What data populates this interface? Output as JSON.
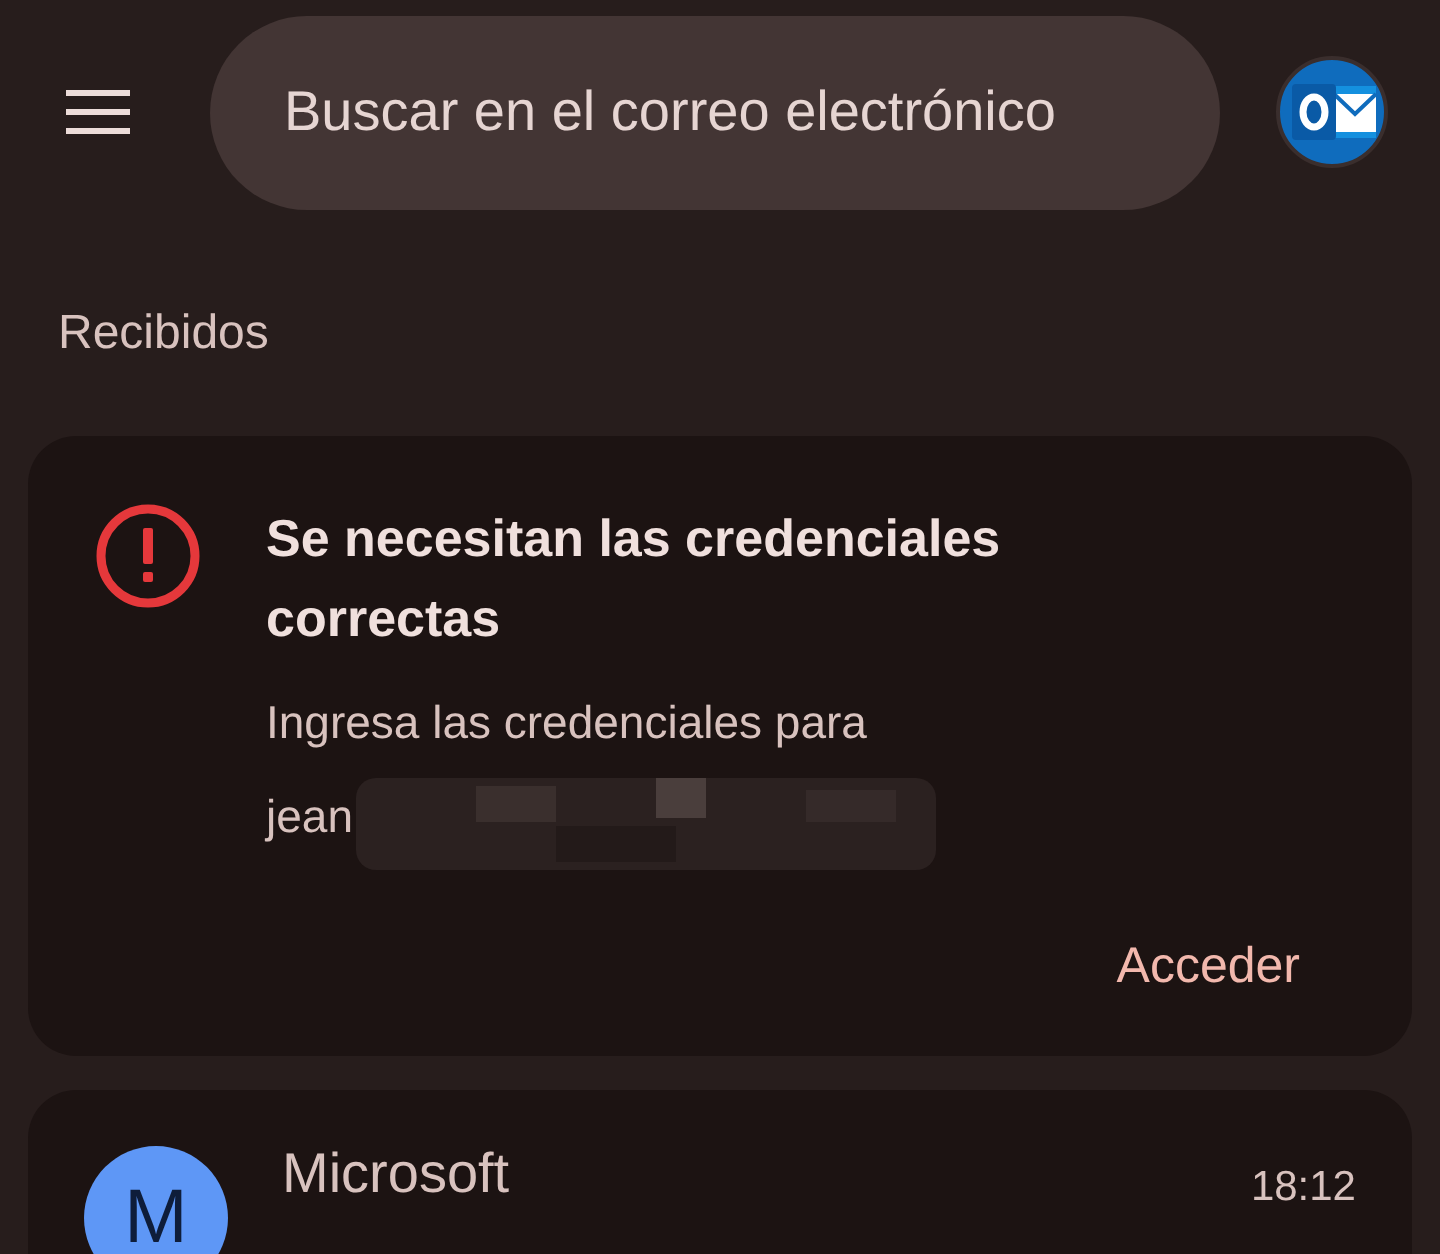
{
  "search": {
    "placeholder": "Buscar en el correo electrónico"
  },
  "section_title": "Recibidos",
  "alert": {
    "title": "Se necesitan las credenciales correctas",
    "message": "Ingresa las credenciales para",
    "account": "jean",
    "action": "Acceder"
  },
  "emails": [
    {
      "avatar_letter": "M",
      "sender": "Microsoft",
      "time": "18:12",
      "color": "#5e97f6"
    }
  ]
}
